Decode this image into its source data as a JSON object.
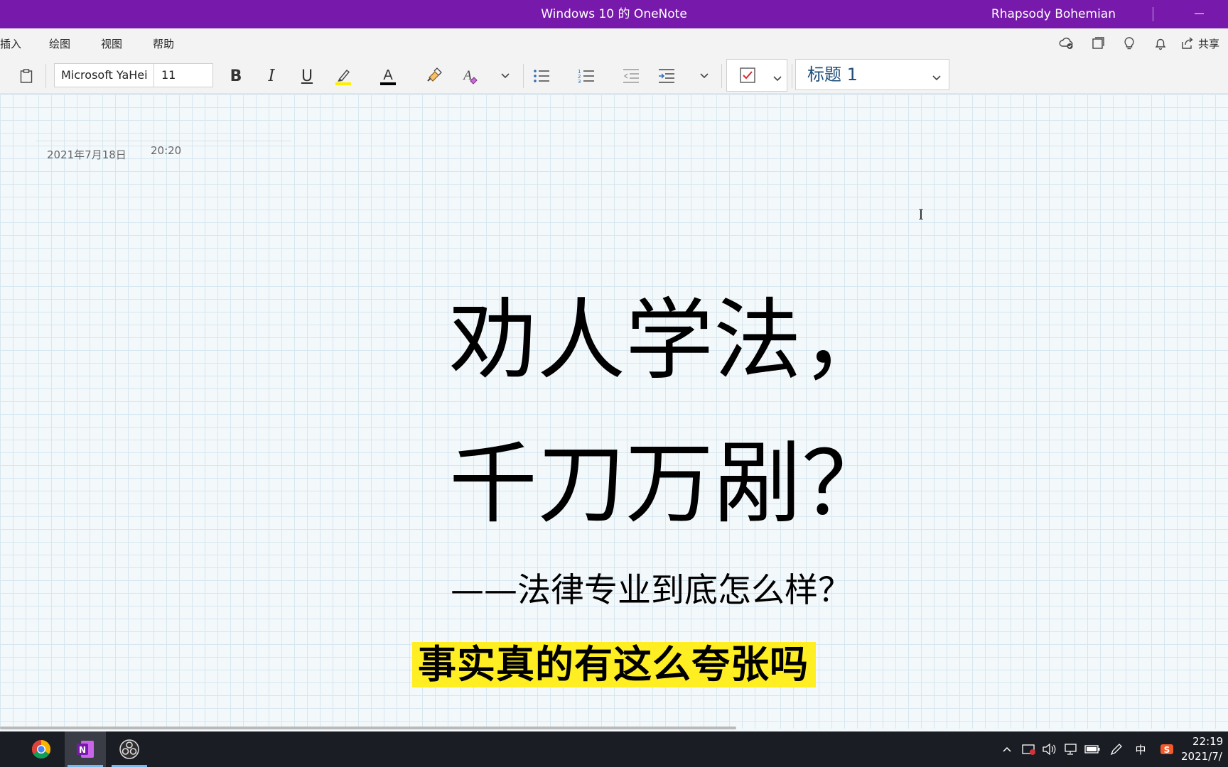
{
  "window": {
    "title": "Windows 10 的 OneNote",
    "user": "Rhapsody Bohemian"
  },
  "menu": {
    "items": [
      "插入",
      "绘图",
      "视图",
      "帮助"
    ],
    "share_label": "共享"
  },
  "ribbon": {
    "font_name": "Microsoft YaHei",
    "font_size": "11",
    "style": "标题 1",
    "bold_label": "B",
    "italic_label": "I",
    "underline_label": "U",
    "font_color_label": "A",
    "accent_color": "#7719aa",
    "highlight_color": "#ffee00",
    "font_color": "#000000"
  },
  "page": {
    "date": "2021年7月18日",
    "time": "20:20",
    "title_line1": "劝人学法，",
    "title_line2": "千刀万剐？",
    "subtitle": "——法律专业到底怎么样？",
    "highlight_text": "事实真的有这么夸张吗",
    "highlight_color": "#ffee22"
  },
  "taskbar": {
    "apps": [
      "chrome-icon",
      "onenote-icon",
      "obs-icon"
    ],
    "ime": "中",
    "clock_time": "22:19",
    "clock_date": "2021/7/"
  }
}
